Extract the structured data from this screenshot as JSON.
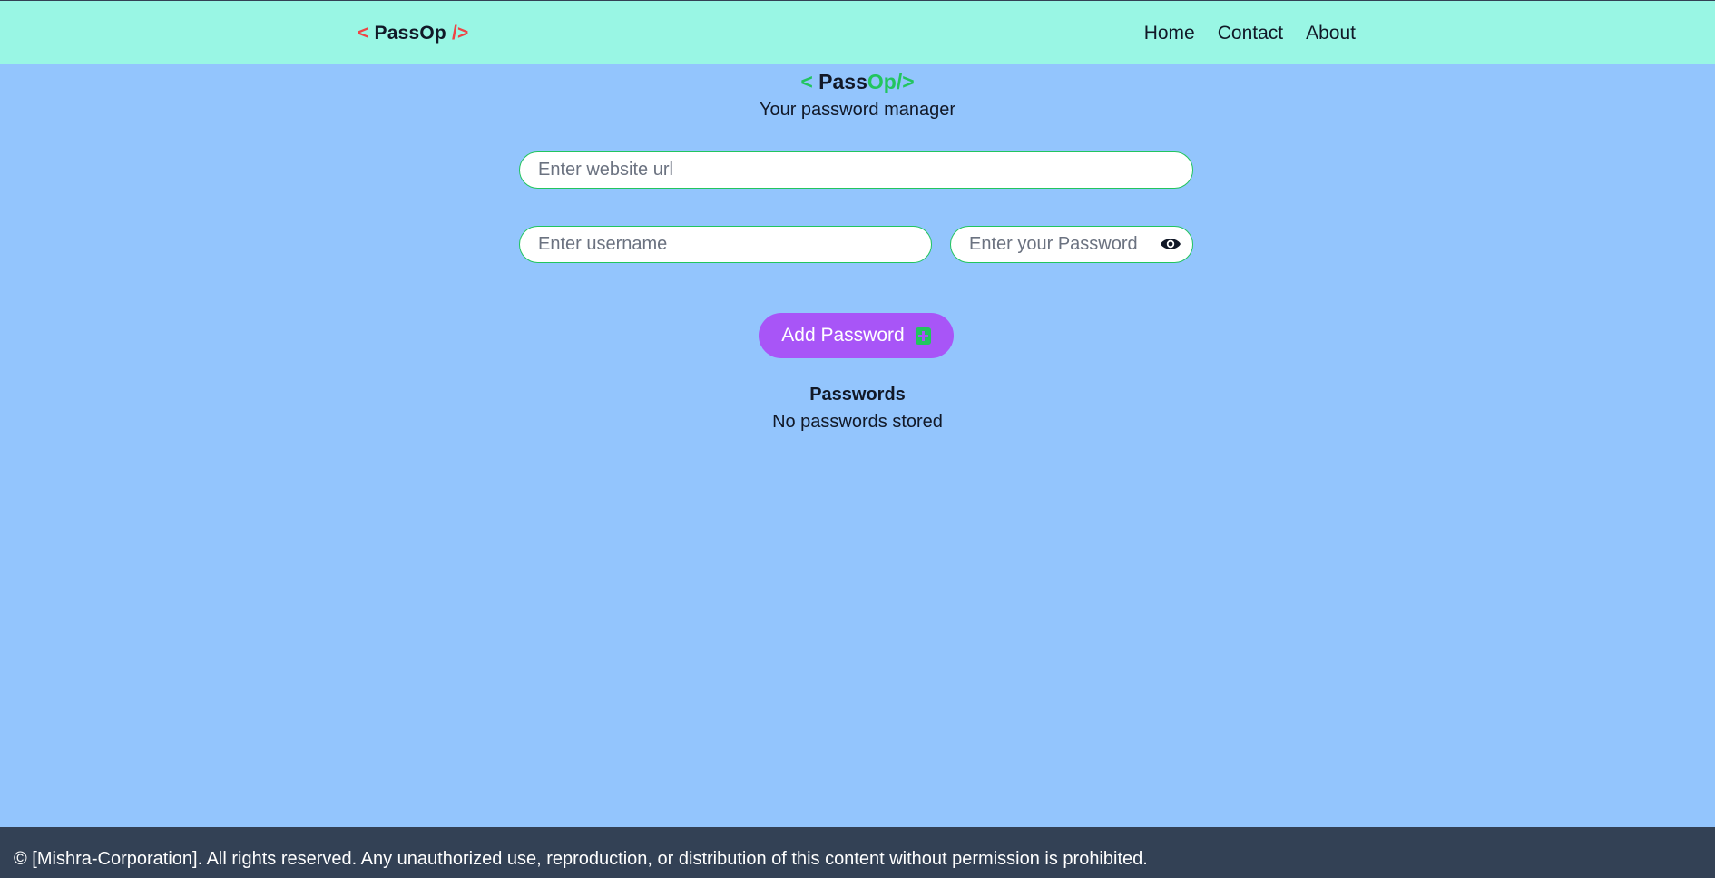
{
  "navbar": {
    "logo": {
      "open": "<",
      "name": "PassOp",
      "close": "/>"
    },
    "links": [
      "Home",
      "Contact",
      "About"
    ]
  },
  "header": {
    "logo": {
      "open": "<",
      "pass": "Pass",
      "op": "Op/>"
    },
    "tagline": "Your password manager"
  },
  "form": {
    "website_placeholder": "Enter website url",
    "username_placeholder": "Enter username",
    "password_placeholder": "Enter your Password",
    "add_button_label": "Add Password",
    "eye_icon": "eye-icon",
    "add_icon": "add-square-icon"
  },
  "passwords": {
    "heading": "Passwords",
    "empty_message": "No passwords stored"
  },
  "footer": {
    "text": "© [Mishra-Corporation]. All rights reserved. Any unauthorized use, reproduction, or distribution of this content without permission is prohibited."
  },
  "colors": {
    "navbar_bg": "#99f6e4",
    "page_bg": "#93c5fd",
    "accent_green": "#22c55e",
    "accent_red": "#ef4444",
    "button_purple": "#a855f7",
    "footer_bg": "#334155"
  }
}
